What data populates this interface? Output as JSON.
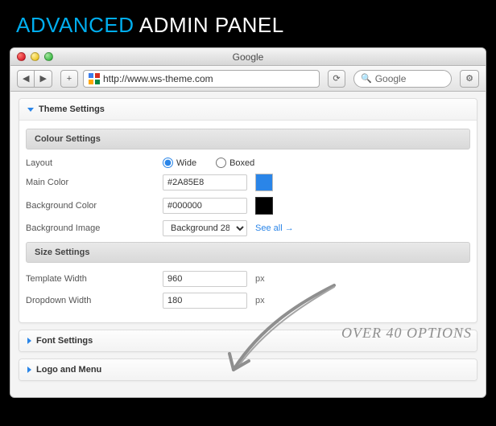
{
  "headline": {
    "accent": "ADVANCED",
    "rest": "ADMIN PANEL"
  },
  "window": {
    "title": "Google",
    "url": "http://www.ws-theme.com",
    "search_placeholder": "Google"
  },
  "panels": {
    "theme": {
      "title": "Theme Settings",
      "colour": {
        "title": "Colour Settings",
        "layout_label": "Layout",
        "layout_wide": "Wide",
        "layout_boxed": "Boxed",
        "main_color_label": "Main Color",
        "main_color_value": "#2A85E8",
        "bg_color_label": "Background Color",
        "bg_color_value": "#000000",
        "bg_image_label": "Background Image",
        "bg_image_value": "Background 28",
        "see_all": "See all →"
      },
      "size": {
        "title": "Size Settings",
        "template_width_label": "Template Width",
        "template_width_value": "960",
        "dropdown_width_label": "Dropdown Width",
        "dropdown_width_value": "180",
        "unit_px": "px"
      }
    },
    "font": {
      "title": "Font Settings"
    },
    "logo": {
      "title": "Logo and Menu"
    }
  },
  "annotation": "OVER 40 OPTIONS"
}
